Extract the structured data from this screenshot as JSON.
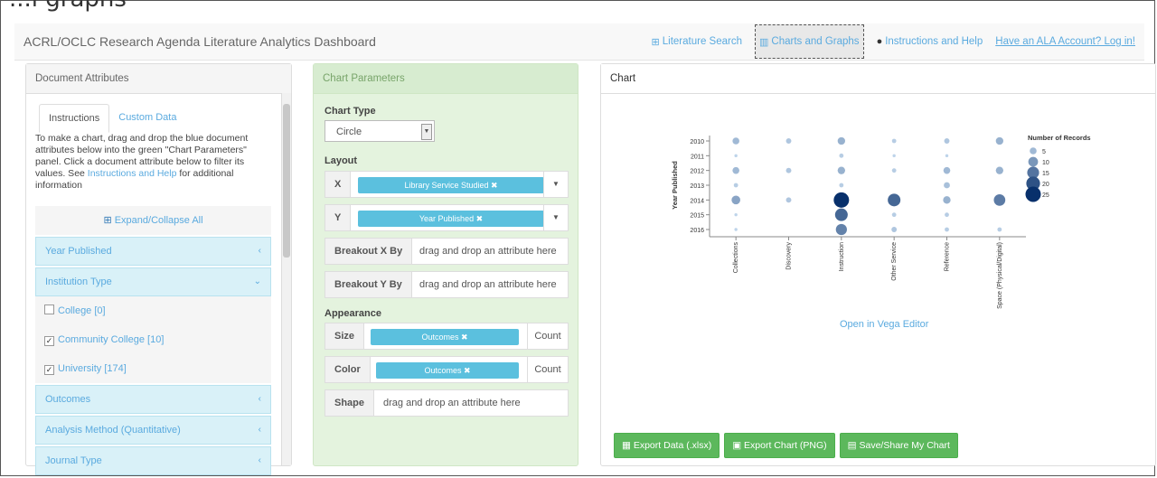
{
  "caption": "...l graphs",
  "navbar": {
    "title": "ACRL/OCLC Research Agenda Literature Analytics Dashboard",
    "links": [
      {
        "label": "Literature Search",
        "icon": "search-icon"
      },
      {
        "label": "Charts and Graphs",
        "icon": "bar-chart-icon"
      },
      {
        "label": "Instructions and Help",
        "icon": "info-circle-icon"
      },
      {
        "label": "Have an ALA Account? Log in!"
      }
    ]
  },
  "left": {
    "title": "Document Attributes",
    "tabs": [
      "Instructions",
      "Custom Data"
    ],
    "intro_text": "To make a chart, drag and drop the blue document attributes below into the green \"Chart Parameters\" panel. Click a document attribute below to filter its values. See ",
    "intro_link": "Instructions and Help",
    "intro_tail": " for additional information",
    "expand_label": "Expand/Collapse All",
    "attributes": [
      "Year Published",
      "Institution Type",
      "Outcomes",
      "Analysis Method (Quantitative)",
      "Journal Type"
    ],
    "institution_options": [
      {
        "label": "College [0]",
        "checked": false
      },
      {
        "label": "Community College [10]",
        "checked": true
      },
      {
        "label": "University [174]",
        "checked": true
      }
    ]
  },
  "middle": {
    "title": "Chart Parameters",
    "chart_type_label": "Chart Type",
    "chart_type_value": "Circle",
    "layout_label": "Layout",
    "x_label": "X",
    "x_value": "Library Service Studied ✖",
    "y_label": "Y",
    "y_value": "Year Published ✖",
    "breakout_x_label": "Breakout X By",
    "breakout_y_label": "Breakout Y By",
    "drop_placeholder": "drag and drop an attribute here",
    "appearance_label": "Appearance",
    "size_label": "Size",
    "size_value": "Outcomes ✖",
    "color_label": "Color",
    "color_value": "Outcomes ✖",
    "count_label": "Count",
    "shape_label": "Shape"
  },
  "right": {
    "title": "Chart",
    "vega_link": "Open in Vega Editor",
    "buttons": [
      "Export Data (.xlsx)",
      "Export Chart (PNG)",
      "Save/Share My Chart"
    ]
  },
  "chart_data": {
    "type": "scatter",
    "xlabel": "Library Service Studied",
    "ylabel": "Year Published",
    "categories": [
      "Collections",
      "Discovery",
      "Instruction",
      "Other Service",
      "Reference",
      "Space (Physical/Digital)"
    ],
    "years": [
      "2010",
      "2011",
      "2012",
      "2013",
      "2014",
      "2015",
      "2016"
    ],
    "legend_title": "Number of Records",
    "legend_values": [
      5,
      10,
      15,
      20,
      25
    ],
    "colors": {
      "min": "#c6dbef",
      "max": "#08306b"
    },
    "points": [
      {
        "x": "Collections",
        "y": "2010",
        "value": 5
      },
      {
        "x": "Discovery",
        "y": "2010",
        "value": 3
      },
      {
        "x": "Instruction",
        "y": "2010",
        "value": 6
      },
      {
        "x": "Other Service",
        "y": "2010",
        "value": 2
      },
      {
        "x": "Reference",
        "y": "2010",
        "value": 3
      },
      {
        "x": "Space (Physical/Digital)",
        "y": "2010",
        "value": 6
      },
      {
        "x": "Collections",
        "y": "2011",
        "value": 1
      },
      {
        "x": "Instruction",
        "y": "2011",
        "value": 2
      },
      {
        "x": "Other Service",
        "y": "2011",
        "value": 1
      },
      {
        "x": "Reference",
        "y": "2011",
        "value": 1
      },
      {
        "x": "Collections",
        "y": "2012",
        "value": 5
      },
      {
        "x": "Discovery",
        "y": "2012",
        "value": 3
      },
      {
        "x": "Instruction",
        "y": "2012",
        "value": 6
      },
      {
        "x": "Other Service",
        "y": "2012",
        "value": 2
      },
      {
        "x": "Reference",
        "y": "2012",
        "value": 5
      },
      {
        "x": "Space (Physical/Digital)",
        "y": "2012",
        "value": 6
      },
      {
        "x": "Collections",
        "y": "2013",
        "value": 2
      },
      {
        "x": "Instruction",
        "y": "2013",
        "value": 2
      },
      {
        "x": "Reference",
        "y": "2013",
        "value": 4
      },
      {
        "x": "Collections",
        "y": "2014",
        "value": 8
      },
      {
        "x": "Discovery",
        "y": "2014",
        "value": 3
      },
      {
        "x": "Instruction",
        "y": "2014",
        "value": 25
      },
      {
        "x": "Other Service",
        "y": "2014",
        "value": 17
      },
      {
        "x": "Reference",
        "y": "2014",
        "value": 6
      },
      {
        "x": "Space (Physical/Digital)",
        "y": "2014",
        "value": 14
      },
      {
        "x": "Collections",
        "y": "2015",
        "value": 1
      },
      {
        "x": "Instruction",
        "y": "2015",
        "value": 17
      },
      {
        "x": "Other Service",
        "y": "2015",
        "value": 2
      },
      {
        "x": "Reference",
        "y": "2015",
        "value": 2
      },
      {
        "x": "Collections",
        "y": "2016",
        "value": 1
      },
      {
        "x": "Instruction",
        "y": "2016",
        "value": 13
      },
      {
        "x": "Other Service",
        "y": "2016",
        "value": 3
      },
      {
        "x": "Reference",
        "y": "2016",
        "value": 2
      },
      {
        "x": "Space (Physical/Digital)",
        "y": "2016",
        "value": 2
      }
    ]
  }
}
